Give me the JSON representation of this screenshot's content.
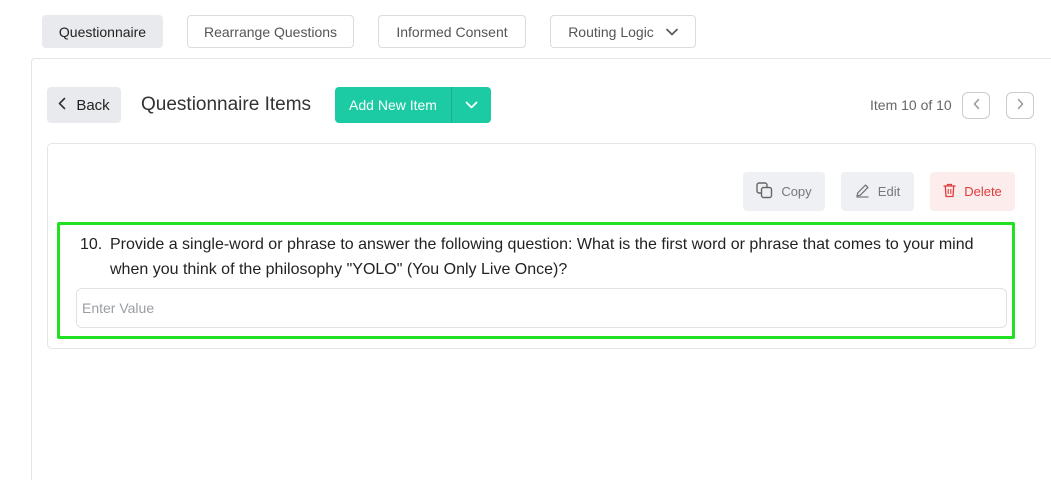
{
  "tabs": [
    {
      "label": "Questionnaire",
      "active": true
    },
    {
      "label": "Rearrange Questions",
      "active": false
    },
    {
      "label": "Informed Consent",
      "active": false
    },
    {
      "label": "Routing Logic",
      "active": false,
      "has_dropdown": true
    }
  ],
  "header": {
    "back_label": "Back",
    "title": "Questionnaire Items",
    "add_item_label": "Add New Item",
    "item_counter": "Item 10 of 10"
  },
  "actions": {
    "copy_label": "Copy",
    "edit_label": "Edit",
    "delete_label": "Delete"
  },
  "question": {
    "number": "10.",
    "text": "Provide a single-word or phrase to answer the following question: What is the first word or phrase that comes to your mind when you think of the philosophy \"YOLO\" (You Only Live Once)?",
    "input_value": "",
    "input_placeholder": "Enter Value"
  },
  "colors": {
    "accent": "#1ccba4",
    "delete": "#e03b3b",
    "highlight": "#22e022"
  },
  "icons": {
    "back": "chevron-left-icon",
    "add_dropdown": "chevron-down-icon",
    "prev": "chevron-left-icon",
    "next": "chevron-right-icon",
    "copy": "copy-icon",
    "edit": "pencil-icon",
    "delete": "trash-icon",
    "routing_dropdown": "chevron-down-icon"
  }
}
